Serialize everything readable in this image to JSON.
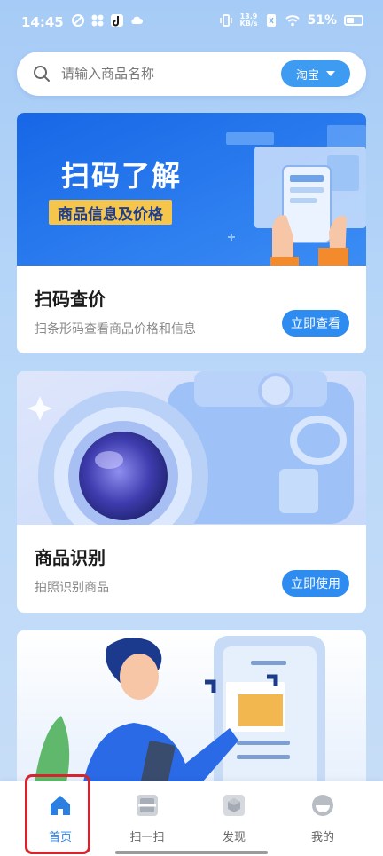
{
  "status_bar": {
    "time": "14:45",
    "net_speed_value": "13.9",
    "net_speed_unit": "KB/s",
    "battery": "51%"
  },
  "search": {
    "placeholder": "请输入商品名称",
    "platform": "淘宝"
  },
  "cards": [
    {
      "banner_headline": "扫码了解",
      "banner_tag": "商品信息及价格",
      "title": "扫码查价",
      "subtitle": "扫条形码查看商品价格和信息",
      "button": "立即查看"
    },
    {
      "title": "商品识别",
      "subtitle": "拍照识别商品",
      "button": "立即使用"
    }
  ],
  "nav": {
    "items": [
      {
        "label": "首页",
        "icon": "home-icon",
        "active": true
      },
      {
        "label": "扫一扫",
        "icon": "scan-icon",
        "active": false
      },
      {
        "label": "发现",
        "icon": "discover-icon",
        "active": false
      },
      {
        "label": "我的",
        "icon": "profile-icon",
        "active": false
      }
    ]
  },
  "colors": {
    "accent": "#2e8cf0",
    "nav_active": "#2b7fe3",
    "highlight": "#d4252f"
  }
}
